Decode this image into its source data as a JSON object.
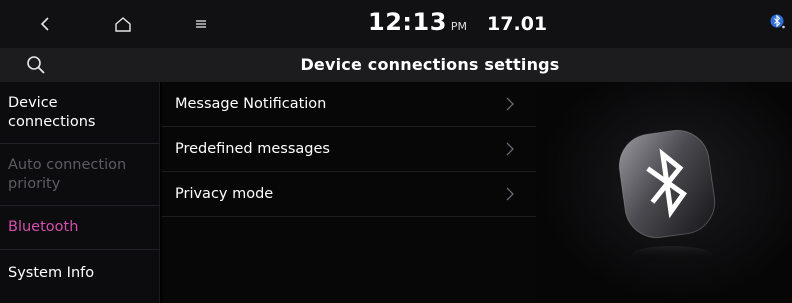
{
  "status_bar": {
    "time": "12:13",
    "ampm": "PM",
    "date": "17.01",
    "icons": [
      "back-arrow-icon",
      "home-icon",
      "menu-icon",
      "bluetooth-status-icon"
    ]
  },
  "title_bar": {
    "title": "Device connections settings",
    "icons": [
      "search-icon"
    ]
  },
  "sidebar": {
    "items": [
      {
        "label": "Device connections",
        "state": "normal"
      },
      {
        "label": "Auto connection priority",
        "state": "disabled"
      },
      {
        "label": "Bluetooth",
        "state": "selected"
      },
      {
        "label": "System Info",
        "state": "normal"
      }
    ]
  },
  "list": {
    "rows": [
      {
        "label": "Message Notification"
      },
      {
        "label": "Predefined messages"
      },
      {
        "label": "Privacy mode"
      }
    ],
    "row_icon": "chevron-right-icon"
  },
  "right_panel": {
    "icon": "bluetooth-logo-icon"
  },
  "colors": {
    "selected_accent": "#d44fb0",
    "disabled_text": "#5c5c62",
    "background": "#000000"
  }
}
